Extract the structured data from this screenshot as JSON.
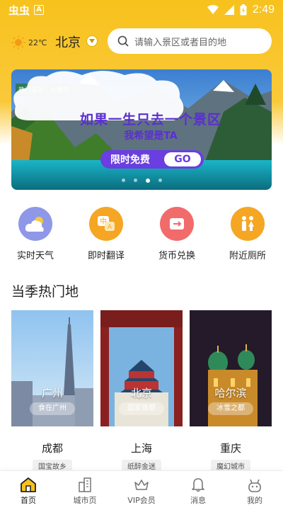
{
  "status_bar": {
    "time": "2:49",
    "left_glyphs": "虫虫",
    "notification_badge": "A"
  },
  "header": {
    "temperature": "22℃",
    "city": "北京",
    "search_placeholder": "请输入景区或者目的地"
  },
  "banner": {
    "tag": "热门景区：九寨沟",
    "title": "如果一生只去一个景区",
    "subtitle": "我希望是TA",
    "button_label": "限时免费",
    "button_go": "GO",
    "slide_count": 4,
    "active_slide": 3
  },
  "quick_actions": [
    {
      "label": "实时天气",
      "icon": "weather-icon",
      "color": "#8f97e8"
    },
    {
      "label": "即时翻译",
      "icon": "translate-icon",
      "color": "#f5a623"
    },
    {
      "label": "货币兑换",
      "icon": "currency-icon",
      "color": "#f26b6b"
    },
    {
      "label": "附近厕所",
      "icon": "toilet-icon",
      "color": "#f5a623"
    }
  ],
  "section": {
    "title": "当季热门地"
  },
  "featured_cities": [
    {
      "name": "广州",
      "tag": "食在广州"
    },
    {
      "name": "北京",
      "tag": "国家首都"
    },
    {
      "name": "哈尔滨",
      "tag": "冰雪之都"
    }
  ],
  "more_cities": [
    {
      "name": "成都",
      "tag": "国宝故乡"
    },
    {
      "name": "上海",
      "tag": "纸醉金迷"
    },
    {
      "name": "重庆",
      "tag": "魔幻城市"
    }
  ],
  "tabs": [
    {
      "label": "首页",
      "icon": "home-icon"
    },
    {
      "label": "城市页",
      "icon": "city-icon"
    },
    {
      "label": "VIP会员",
      "icon": "crown-icon"
    },
    {
      "label": "消息",
      "icon": "bell-icon"
    },
    {
      "label": "我的",
      "icon": "profile-icon"
    }
  ],
  "colors": {
    "brand_yellow": "#f7c21d",
    "promo_purple": "#5a2fd0"
  }
}
